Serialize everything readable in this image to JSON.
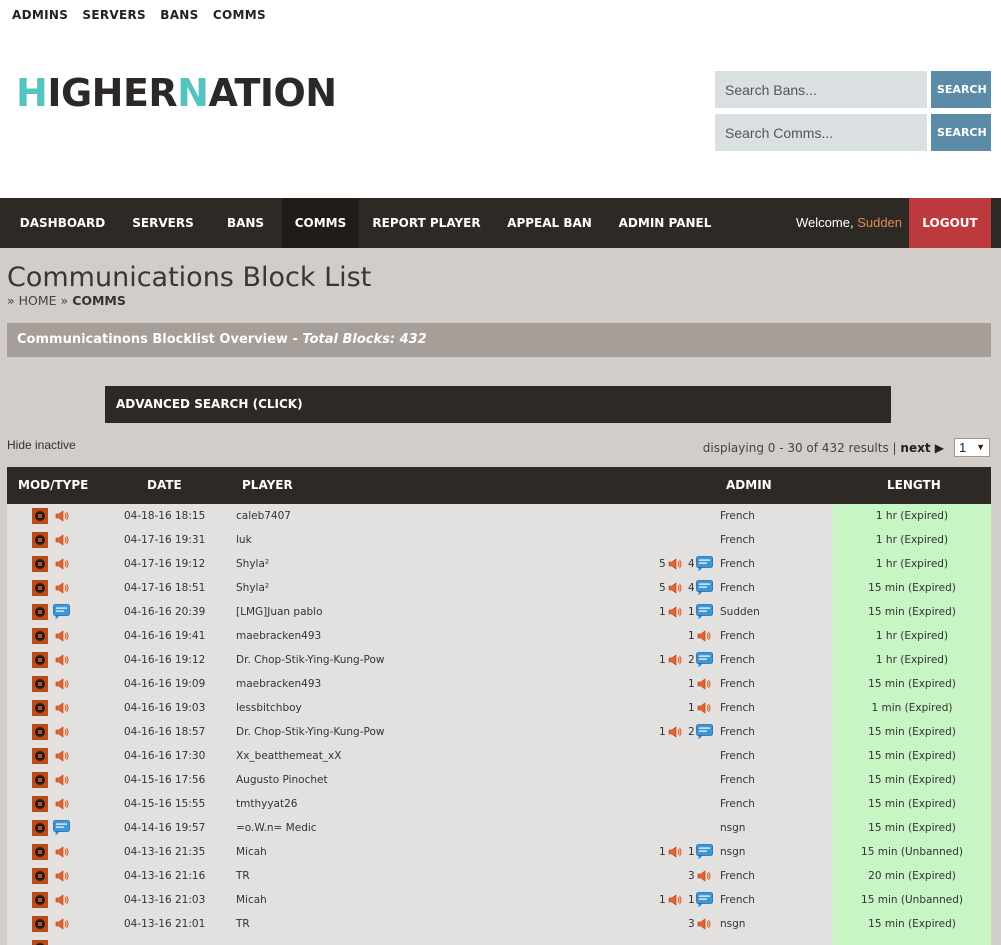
{
  "top_links": [
    "ADMINS",
    "SERVERS",
    "BANS",
    "COMMS"
  ],
  "logo": {
    "part1": "H",
    "part2": "IGHER",
    "part3": "N",
    "part4": "ATION"
  },
  "search": {
    "bans_placeholder": "Search Bans...",
    "comms_placeholder": "Search Comms...",
    "button_label": "SEARCH"
  },
  "nav": {
    "items": [
      "DASHBOARD",
      "SERVERS",
      "BANS",
      "COMMS",
      "REPORT PLAYER",
      "APPEAL BAN",
      "ADMIN PANEL"
    ],
    "active": "COMMS",
    "welcome_label": "Welcome,",
    "username": "Sudden",
    "logout_label": "LOGOUT"
  },
  "page": {
    "title": "Communications Block List",
    "breadcrumb_sep": "»",
    "breadcrumb_home": "HOME",
    "breadcrumb_current": "COMMS",
    "overview_label": "Communicatinons Blocklist Overview -",
    "overview_total": "Total Blocks: 432",
    "advanced_search": "ADVANCED SEARCH (CLICK)",
    "hide_inactive": "Hide inactive",
    "paging_text": "displaying 0 - 30 of 432 results |",
    "next_label": "next ▶",
    "page_select_value": "1"
  },
  "colors": {
    "accent_teal": "#54c4bf",
    "nav_dark": "#2d2925",
    "logout_red": "#bc3a3d",
    "search_blue": "#5c8ba7",
    "length_green": "#c7f5c4"
  },
  "table": {
    "headers": [
      "MOD/TYPE",
      "DATE",
      "PLAYER",
      "ADMIN",
      "LENGTH"
    ],
    "rows": [
      {
        "type": "voice",
        "date": "04-18-16 18:15",
        "player": "caleb7407",
        "mutes": "",
        "gags": "",
        "admin": "French",
        "length": "1 hr (Expired)"
      },
      {
        "type": "voice",
        "date": "04-17-16 19:31",
        "player": "luk",
        "mutes": "",
        "gags": "",
        "admin": "French",
        "length": "1 hr (Expired)"
      },
      {
        "type": "voice",
        "date": "04-17-16 19:12",
        "player": "Shyla²",
        "mutes": "5",
        "gags": "4",
        "admin": "French",
        "length": "1 hr (Expired)"
      },
      {
        "type": "voice",
        "date": "04-17-16 18:51",
        "player": "Shyla²",
        "mutes": "5",
        "gags": "4",
        "admin": "French",
        "length": "15 min (Expired)"
      },
      {
        "type": "chat",
        "date": "04-16-16 20:39",
        "player": "[LMG]Juan pablo",
        "mutes": "1",
        "gags": "1",
        "admin": "Sudden",
        "length": "15 min (Expired)"
      },
      {
        "type": "voice",
        "date": "04-16-16 19:41",
        "player": "maebracken493",
        "mutes": "1",
        "gags": "",
        "admin": "French",
        "length": "1 hr (Expired)"
      },
      {
        "type": "voice",
        "date": "04-16-16 19:12",
        "player": "Dr. Chop-Stik-Ying-Kung-Pow",
        "mutes": "1",
        "gags": "2",
        "admin": "French",
        "length": "1 hr (Expired)"
      },
      {
        "type": "voice",
        "date": "04-16-16 19:09",
        "player": "maebracken493",
        "mutes": "1",
        "gags": "",
        "admin": "French",
        "length": "15 min (Expired)"
      },
      {
        "type": "voice",
        "date": "04-16-16 19:03",
        "player": "lessbitchboy",
        "mutes": "1",
        "gags": "",
        "admin": "French",
        "length": "1 min (Expired)"
      },
      {
        "type": "voice",
        "date": "04-16-16 18:57",
        "player": "Dr. Chop-Stik-Ying-Kung-Pow",
        "mutes": "1",
        "gags": "2",
        "admin": "French",
        "length": "15 min (Expired)"
      },
      {
        "type": "voice",
        "date": "04-16-16 17:30",
        "player": "Xx_beatthemeat_xX",
        "mutes": "",
        "gags": "",
        "admin": "French",
        "length": "15 min (Expired)"
      },
      {
        "type": "voice",
        "date": "04-15-16 17:56",
        "player": "Augusto Pinochet",
        "mutes": "",
        "gags": "",
        "admin": "French",
        "length": "15 min (Expired)"
      },
      {
        "type": "voice",
        "date": "04-15-16 15:55",
        "player": "tmthyyat26",
        "mutes": "",
        "gags": "",
        "admin": "French",
        "length": "15 min (Expired)"
      },
      {
        "type": "chat",
        "date": "04-14-16 19:57",
        "player": "=o.W.n= Medic",
        "mutes": "",
        "gags": "",
        "admin": "nsgn",
        "length": "15 min (Expired)"
      },
      {
        "type": "voice",
        "date": "04-13-16 21:35",
        "player": "Micah",
        "mutes": "1",
        "gags": "1",
        "admin": "nsgn",
        "length": "15 min (Unbanned)"
      },
      {
        "type": "voice",
        "date": "04-13-16 21:16",
        "player": "TR",
        "mutes": "3",
        "gags": "",
        "admin": "French",
        "length": "20 min (Expired)"
      },
      {
        "type": "voice",
        "date": "04-13-16 21:03",
        "player": "Micah",
        "mutes": "1",
        "gags": "1",
        "admin": "French",
        "length": "15 min (Unbanned)"
      },
      {
        "type": "voice",
        "date": "04-13-16 21:01",
        "player": "TR",
        "mutes": "3",
        "gags": "",
        "admin": "nsgn",
        "length": "15 min (Expired)"
      }
    ]
  }
}
